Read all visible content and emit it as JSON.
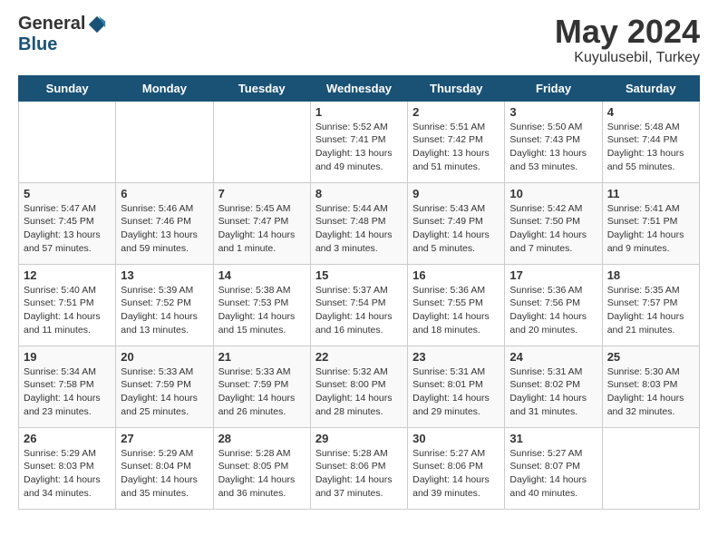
{
  "header": {
    "logo_general": "General",
    "logo_blue": "Blue",
    "month_title": "May 2024",
    "location": "Kuyulusebil, Turkey"
  },
  "weekdays": [
    "Sunday",
    "Monday",
    "Tuesday",
    "Wednesday",
    "Thursday",
    "Friday",
    "Saturday"
  ],
  "weeks": [
    [
      {
        "day": "",
        "info": ""
      },
      {
        "day": "",
        "info": ""
      },
      {
        "day": "",
        "info": ""
      },
      {
        "day": "1",
        "info": "Sunrise: 5:52 AM\nSunset: 7:41 PM\nDaylight: 13 hours\nand 49 minutes."
      },
      {
        "day": "2",
        "info": "Sunrise: 5:51 AM\nSunset: 7:42 PM\nDaylight: 13 hours\nand 51 minutes."
      },
      {
        "day": "3",
        "info": "Sunrise: 5:50 AM\nSunset: 7:43 PM\nDaylight: 13 hours\nand 53 minutes."
      },
      {
        "day": "4",
        "info": "Sunrise: 5:48 AM\nSunset: 7:44 PM\nDaylight: 13 hours\nand 55 minutes."
      }
    ],
    [
      {
        "day": "5",
        "info": "Sunrise: 5:47 AM\nSunset: 7:45 PM\nDaylight: 13 hours\nand 57 minutes."
      },
      {
        "day": "6",
        "info": "Sunrise: 5:46 AM\nSunset: 7:46 PM\nDaylight: 13 hours\nand 59 minutes."
      },
      {
        "day": "7",
        "info": "Sunrise: 5:45 AM\nSunset: 7:47 PM\nDaylight: 14 hours\nand 1 minute."
      },
      {
        "day": "8",
        "info": "Sunrise: 5:44 AM\nSunset: 7:48 PM\nDaylight: 14 hours\nand 3 minutes."
      },
      {
        "day": "9",
        "info": "Sunrise: 5:43 AM\nSunset: 7:49 PM\nDaylight: 14 hours\nand 5 minutes."
      },
      {
        "day": "10",
        "info": "Sunrise: 5:42 AM\nSunset: 7:50 PM\nDaylight: 14 hours\nand 7 minutes."
      },
      {
        "day": "11",
        "info": "Sunrise: 5:41 AM\nSunset: 7:51 PM\nDaylight: 14 hours\nand 9 minutes."
      }
    ],
    [
      {
        "day": "12",
        "info": "Sunrise: 5:40 AM\nSunset: 7:51 PM\nDaylight: 14 hours\nand 11 minutes."
      },
      {
        "day": "13",
        "info": "Sunrise: 5:39 AM\nSunset: 7:52 PM\nDaylight: 14 hours\nand 13 minutes."
      },
      {
        "day": "14",
        "info": "Sunrise: 5:38 AM\nSunset: 7:53 PM\nDaylight: 14 hours\nand 15 minutes."
      },
      {
        "day": "15",
        "info": "Sunrise: 5:37 AM\nSunset: 7:54 PM\nDaylight: 14 hours\nand 16 minutes."
      },
      {
        "day": "16",
        "info": "Sunrise: 5:36 AM\nSunset: 7:55 PM\nDaylight: 14 hours\nand 18 minutes."
      },
      {
        "day": "17",
        "info": "Sunrise: 5:36 AM\nSunset: 7:56 PM\nDaylight: 14 hours\nand 20 minutes."
      },
      {
        "day": "18",
        "info": "Sunrise: 5:35 AM\nSunset: 7:57 PM\nDaylight: 14 hours\nand 21 minutes."
      }
    ],
    [
      {
        "day": "19",
        "info": "Sunrise: 5:34 AM\nSunset: 7:58 PM\nDaylight: 14 hours\nand 23 minutes."
      },
      {
        "day": "20",
        "info": "Sunrise: 5:33 AM\nSunset: 7:59 PM\nDaylight: 14 hours\nand 25 minutes."
      },
      {
        "day": "21",
        "info": "Sunrise: 5:33 AM\nSunset: 7:59 PM\nDaylight: 14 hours\nand 26 minutes."
      },
      {
        "day": "22",
        "info": "Sunrise: 5:32 AM\nSunset: 8:00 PM\nDaylight: 14 hours\nand 28 minutes."
      },
      {
        "day": "23",
        "info": "Sunrise: 5:31 AM\nSunset: 8:01 PM\nDaylight: 14 hours\nand 29 minutes."
      },
      {
        "day": "24",
        "info": "Sunrise: 5:31 AM\nSunset: 8:02 PM\nDaylight: 14 hours\nand 31 minutes."
      },
      {
        "day": "25",
        "info": "Sunrise: 5:30 AM\nSunset: 8:03 PM\nDaylight: 14 hours\nand 32 minutes."
      }
    ],
    [
      {
        "day": "26",
        "info": "Sunrise: 5:29 AM\nSunset: 8:03 PM\nDaylight: 14 hours\nand 34 minutes."
      },
      {
        "day": "27",
        "info": "Sunrise: 5:29 AM\nSunset: 8:04 PM\nDaylight: 14 hours\nand 35 minutes."
      },
      {
        "day": "28",
        "info": "Sunrise: 5:28 AM\nSunset: 8:05 PM\nDaylight: 14 hours\nand 36 minutes."
      },
      {
        "day": "29",
        "info": "Sunrise: 5:28 AM\nSunset: 8:06 PM\nDaylight: 14 hours\nand 37 minutes."
      },
      {
        "day": "30",
        "info": "Sunrise: 5:27 AM\nSunset: 8:06 PM\nDaylight: 14 hours\nand 39 minutes."
      },
      {
        "day": "31",
        "info": "Sunrise: 5:27 AM\nSunset: 8:07 PM\nDaylight: 14 hours\nand 40 minutes."
      },
      {
        "day": "",
        "info": ""
      }
    ]
  ]
}
